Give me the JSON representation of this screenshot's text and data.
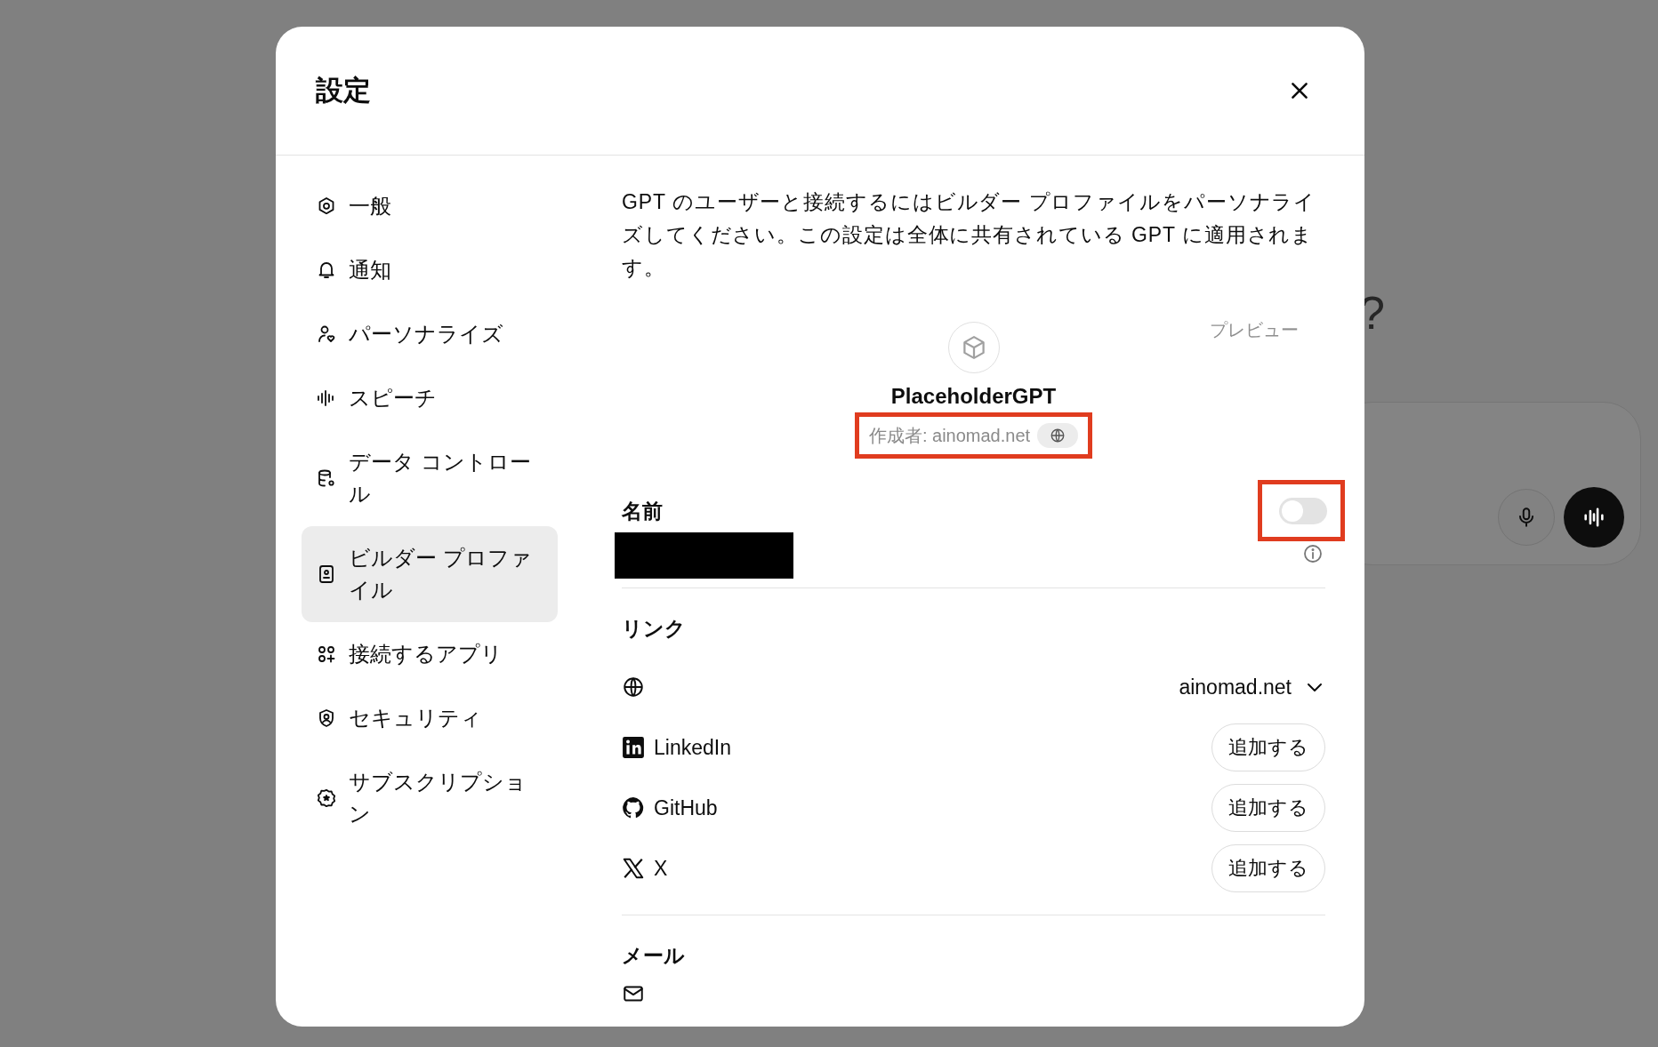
{
  "background": {
    "heading_fragment": "?"
  },
  "dialog": {
    "title": "設定"
  },
  "sidebar": {
    "items": [
      {
        "label": "一般",
        "selected": false
      },
      {
        "label": "通知",
        "selected": false
      },
      {
        "label": "パーソナライズ",
        "selected": false
      },
      {
        "label": "スピーチ",
        "selected": false
      },
      {
        "label": "データ コントロール",
        "selected": false
      },
      {
        "label": "ビルダー プロファイル",
        "selected": true
      },
      {
        "label": "接続するアプリ",
        "selected": false
      },
      {
        "label": "セキュリティ",
        "selected": false
      },
      {
        "label": "サブスクリプション",
        "selected": false
      }
    ]
  },
  "description": "GPT のユーザーと接続するにはビルダー プロファイルをパーソナライズしてください。この設定は全体に共有されている GPT に適用されます。",
  "preview": {
    "label": "プレビュー",
    "name": "PlaceholderGPT",
    "author": "作成者: ainomad.net",
    "highlighted": true
  },
  "name_section": {
    "heading": "名前",
    "redacted": true,
    "toggle": {
      "on": false,
      "highlighted": true
    }
  },
  "links": {
    "heading": "リンク",
    "items": [
      {
        "kind": "website",
        "value": "ainomad.net"
      },
      {
        "kind": "linkedin",
        "label": "LinkedIn",
        "button": "追加する"
      },
      {
        "kind": "github",
        "label": "GitHub",
        "button": "追加する"
      },
      {
        "kind": "x",
        "label": "X",
        "button": "追加する"
      }
    ]
  },
  "email": {
    "heading": "メール"
  }
}
